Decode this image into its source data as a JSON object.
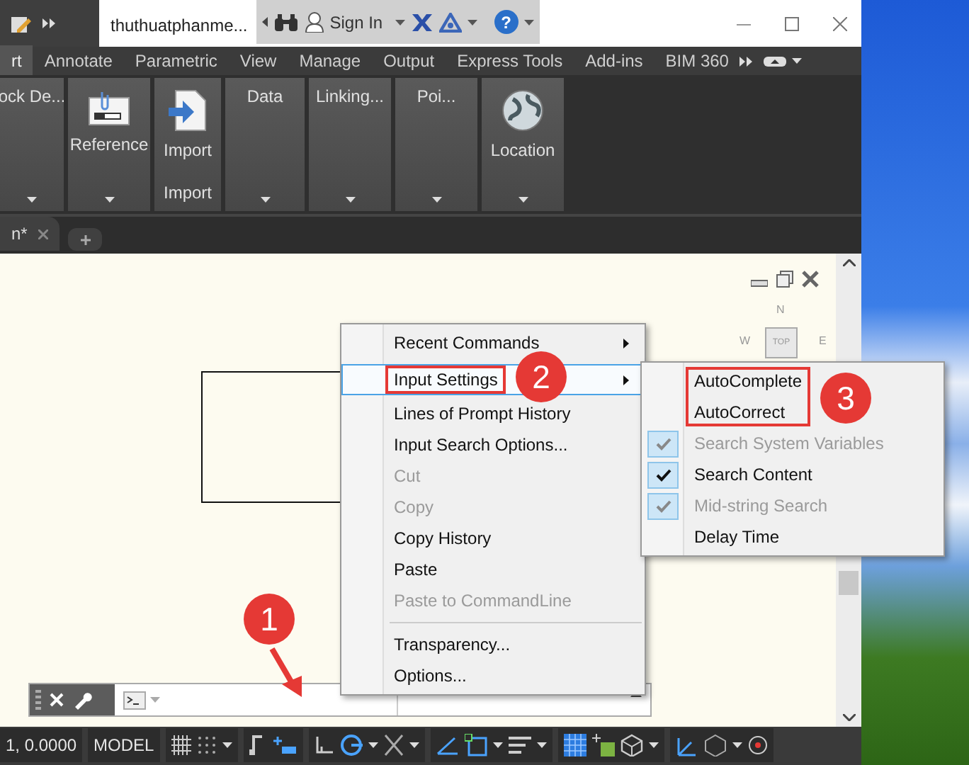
{
  "title_bar": {
    "title": "thuthuatphanme...",
    "sign_in": "Sign In",
    "help": "?"
  },
  "ribbon_tabs": [
    {
      "label": "rt",
      "selected": true
    },
    {
      "label": "Annotate",
      "selected": false
    },
    {
      "label": "Parametric",
      "selected": false
    },
    {
      "label": "View",
      "selected": false
    },
    {
      "label": "Manage",
      "selected": false
    },
    {
      "label": "Output",
      "selected": false
    },
    {
      "label": "Express Tools",
      "selected": false
    },
    {
      "label": "Add-ins",
      "selected": false
    },
    {
      "label": "BIM 360",
      "selected": false
    }
  ],
  "ribbon_panels": [
    {
      "label": "ock De...",
      "kind": "text"
    },
    {
      "label": "Reference",
      "kind": "reference"
    },
    {
      "label": "Import",
      "kind": "import",
      "footer": "Import"
    },
    {
      "label": "Data",
      "kind": "text"
    },
    {
      "label": "Linking...",
      "kind": "text"
    },
    {
      "label": "Poi...",
      "kind": "text"
    },
    {
      "label": "Location",
      "kind": "location"
    }
  ],
  "document_tabs": [
    {
      "label": "n*"
    }
  ],
  "viewcube": {
    "north": "N",
    "west": "W",
    "top": "TOP",
    "east": "E"
  },
  "context_menu": {
    "groups": [
      [
        {
          "label": "Recent Commands",
          "submenu": true,
          "disabled": false,
          "selected": false,
          "annotated": false
        },
        {
          "label": "Input Settings",
          "submenu": true,
          "disabled": false,
          "selected": true,
          "annotated": true
        },
        {
          "label": "Lines of Prompt History",
          "submenu": false,
          "disabled": false,
          "selected": false,
          "annotated": false
        },
        {
          "label": "Input Search Options...",
          "submenu": false,
          "disabled": false,
          "selected": false,
          "annotated": false
        },
        {
          "label": "Cut",
          "submenu": false,
          "disabled": true,
          "selected": false,
          "annotated": false
        },
        {
          "label": "Copy",
          "submenu": false,
          "disabled": true,
          "selected": false,
          "annotated": false
        },
        {
          "label": "Copy History",
          "submenu": false,
          "disabled": false,
          "selected": false,
          "annotated": false
        },
        {
          "label": "Paste",
          "submenu": false,
          "disabled": false,
          "selected": false,
          "annotated": false
        },
        {
          "label": "Paste to CommandLine",
          "submenu": false,
          "disabled": true,
          "selected": false,
          "annotated": false
        }
      ],
      [
        {
          "label": "Transparency...",
          "submenu": false,
          "disabled": false,
          "selected": false,
          "annotated": false
        },
        {
          "label": "Options...",
          "submenu": false,
          "disabled": false,
          "selected": false,
          "annotated": false
        }
      ]
    ]
  },
  "submenu": {
    "items": [
      {
        "label": "AutoComplete",
        "checked": false,
        "disabled": false,
        "annotated": true
      },
      {
        "label": "AutoCorrect",
        "checked": false,
        "disabled": false,
        "annotated": true
      },
      {
        "label": "Search System Variables",
        "checked": true,
        "disabled": true,
        "annotated": false
      },
      {
        "label": "Search Content",
        "checked": true,
        "disabled": false,
        "annotated": false
      },
      {
        "label": "Mid-string Search",
        "checked": true,
        "disabled": true,
        "annotated": false
      },
      {
        "label": "Delay Time",
        "checked": false,
        "disabled": false,
        "annotated": false
      }
    ]
  },
  "callouts": [
    {
      "number": "1",
      "pointer": true
    },
    {
      "number": "2",
      "pointer": false
    },
    {
      "number": "3",
      "pointer": false
    }
  ],
  "status_bar": {
    "coordinates": "1, 0.0000",
    "space": "MODEL"
  }
}
